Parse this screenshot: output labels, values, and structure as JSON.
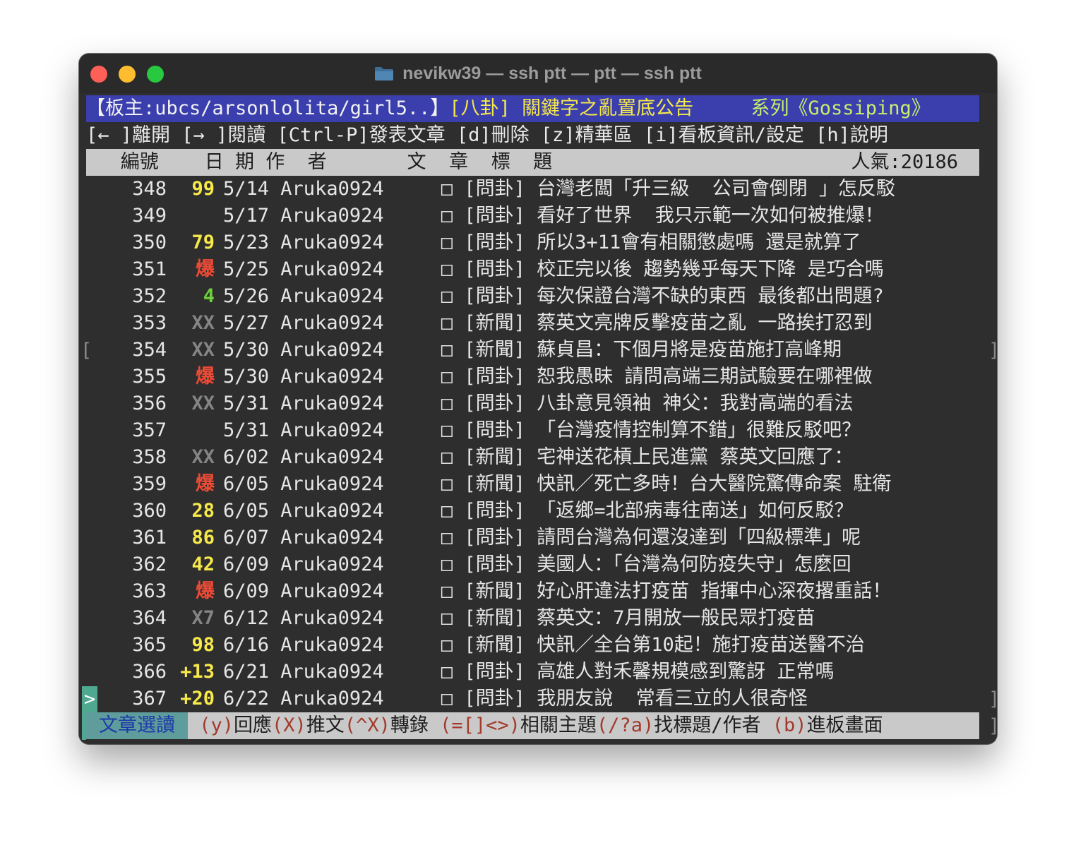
{
  "window": {
    "title": "nevikw39 — ssh ptt — ptt — ssh ptt"
  },
  "header": {
    "part1": "【板主:ubcs/arsonlolita/girl5..】",
    "part2": "[八卦] 關鍵字之亂置底公告",
    "part3": "系列《Gossiping》"
  },
  "commands": "[← ]離開 [→ ]閱讀 [Ctrl-P]發表文章 [d]刪除 [z]精華區 [i]看板資訊/設定 [h]說明",
  "columns": {
    "left": "   編號    日 期 作  者       文  章  標  題",
    "popularity": "人氣:20186"
  },
  "rows": [
    {
      "num": "348",
      "rec": "99",
      "rec_color": "yellow",
      "date": "5/14",
      "author": "Aruka0924",
      "title": "[問卦] 台灣老闆「升三級  公司會倒閉 」怎反駁"
    },
    {
      "num": "349",
      "rec": "",
      "rec_color": "",
      "date": "5/17",
      "author": "Aruka0924",
      "title": "[問卦] 看好了世界  我只示範一次如何被推爆！"
    },
    {
      "num": "350",
      "rec": "79",
      "rec_color": "yellow",
      "date": "5/23",
      "author": "Aruka0924",
      "title": "[問卦] 所以3+11會有相關懲處嗎 還是就算了"
    },
    {
      "num": "351",
      "rec": "爆",
      "rec_color": "red",
      "date": "5/25",
      "author": "Aruka0924",
      "title": "[問卦] 校正完以後 趨勢幾乎每天下降 是巧合嗎"
    },
    {
      "num": "352",
      "rec": "4",
      "rec_color": "green",
      "date": "5/26",
      "author": "Aruka0924",
      "title": "[問卦] 每次保證台灣不缺的東西 最後都出問題?"
    },
    {
      "num": "353",
      "rec": "XX",
      "rec_color": "gray",
      "date": "5/27",
      "author": "Aruka0924",
      "title": "[新聞] 蔡英文亮牌反擊疫苗之亂 一路挨打忍到"
    },
    {
      "num": "354",
      "rec": "XX",
      "rec_color": "gray",
      "date": "5/30",
      "author": "Aruka0924",
      "title": "[新聞] 蘇貞昌：下個月將是疫苗施打高峰期"
    },
    {
      "num": "355",
      "rec": "爆",
      "rec_color": "red",
      "date": "5/30",
      "author": "Aruka0924",
      "title": "[問卦] 恕我愚昧 請問高端三期試驗要在哪裡做"
    },
    {
      "num": "356",
      "rec": "XX",
      "rec_color": "gray",
      "date": "5/31",
      "author": "Aruka0924",
      "title": "[問卦] 八卦意見領袖 神父：我對高端的看法"
    },
    {
      "num": "357",
      "rec": "",
      "rec_color": "",
      "date": "5/31",
      "author": "Aruka0924",
      "title": "[問卦] 「台灣疫情控制算不錯」很難反駁吧？"
    },
    {
      "num": "358",
      "rec": "XX",
      "rec_color": "gray",
      "date": "6/02",
      "author": "Aruka0924",
      "title": "[新聞] 宅神送花槓上民進黨 蔡英文回應了："
    },
    {
      "num": "359",
      "rec": "爆",
      "rec_color": "red",
      "date": "6/05",
      "author": "Aruka0924",
      "title": "[新聞] 快訊／死亡多時！台大醫院驚傳命案 駐衛"
    },
    {
      "num": "360",
      "rec": "28",
      "rec_color": "yellow",
      "date": "6/05",
      "author": "Aruka0924",
      "title": "[問卦] 「返鄉=北部病毒往南送」如何反駁？"
    },
    {
      "num": "361",
      "rec": "86",
      "rec_color": "yellow",
      "date": "6/07",
      "author": "Aruka0924",
      "title": "[問卦] 請問台灣為何還沒達到「四級標準」呢"
    },
    {
      "num": "362",
      "rec": "42",
      "rec_color": "yellow",
      "date": "6/09",
      "author": "Aruka0924",
      "title": "[問卦] 美國人：「台灣為何防疫失守」怎麼回"
    },
    {
      "num": "363",
      "rec": "爆",
      "rec_color": "red",
      "date": "6/09",
      "author": "Aruka0924",
      "title": "[新聞] 好心肝違法打疫苗 指揮中心深夜撂重話！"
    },
    {
      "num": "364",
      "rec": "X7",
      "rec_color": "gray",
      "date": "6/12",
      "author": "Aruka0924",
      "title": "[新聞] 蔡英文：7月開放一般民眾打疫苗"
    },
    {
      "num": "365",
      "rec": "98",
      "rec_color": "yellow",
      "date": "6/16",
      "author": "Aruka0924",
      "title": "[新聞] 快訊／全台第10起！施打疫苗送醫不治"
    },
    {
      "num": "366",
      "rec": "+13",
      "rec_color": "yellow",
      "date": "6/21",
      "author": "Aruka0924",
      "title": "[問卦] 高雄人對禾馨規模感到驚訝 正常嗎"
    },
    {
      "num": "367",
      "rec": "+20",
      "rec_color": "yellow",
      "date": "6/22",
      "author": "Aruka0924",
      "title": "[問卦] 我朋友說  常看三立的人很奇怪"
    }
  ],
  "row_checkbox": "□",
  "cursor": ">",
  "brackets": {
    "left": "[",
    "right": "]"
  },
  "status": {
    "mode": "文章選讀",
    "items": [
      {
        "key": "(y)",
        "label": "回應"
      },
      {
        "key": "(X)",
        "label": "推文"
      },
      {
        "key": "(^X)",
        "label": "轉錄"
      },
      {
        "key": "(=[]<>)",
        "label": "相關主題"
      },
      {
        "key": "(/?a)",
        "label": "找標題/作者"
      },
      {
        "key": "(b)",
        "label": "進板畫面"
      }
    ]
  },
  "colors": {
    "yellow": "#f7e94a",
    "red": "#ef4a36",
    "green": "#6fd13a",
    "gray": "#858585",
    "header_bg": "#3b3fae",
    "bar_bg": "#c9c9c9",
    "cursor_bg": "#4fa890"
  }
}
